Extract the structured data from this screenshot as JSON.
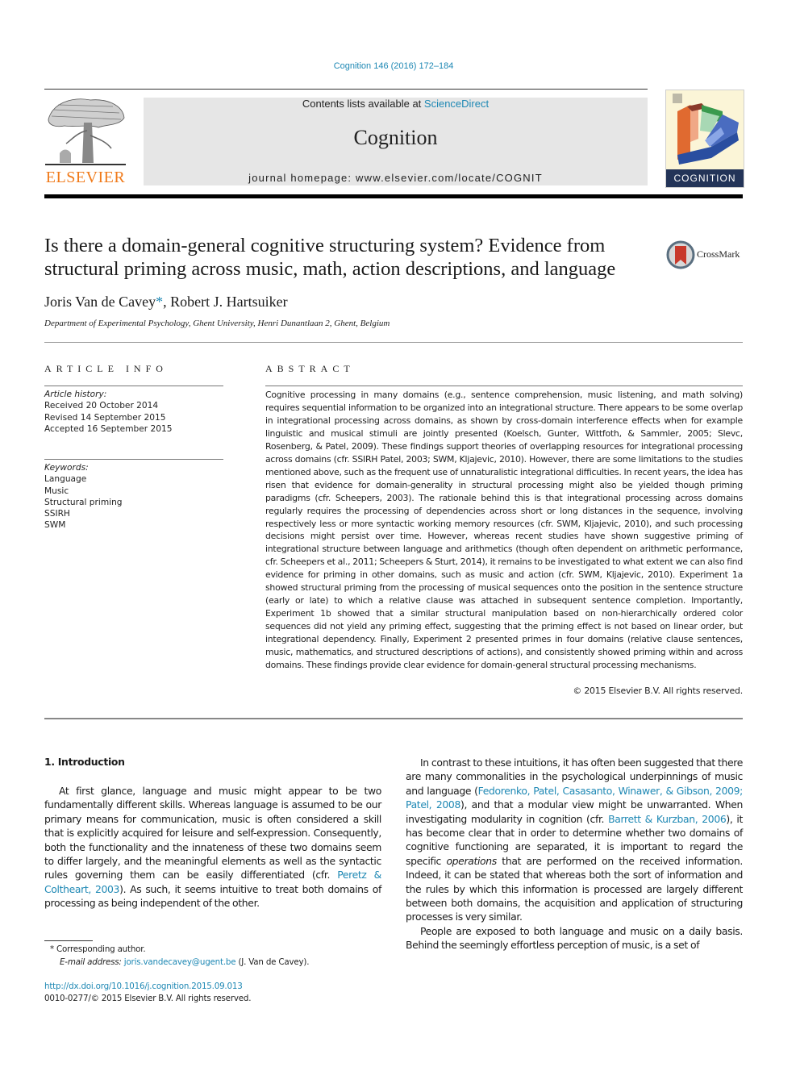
{
  "header": {
    "citation": "Cognition 146 (2016) 172–184",
    "contents_prefix": "Contents lists available at ",
    "contents_link": "ScienceDirect",
    "journal_title": "Cognition",
    "homepage": "journal homepage: www.elsevier.com/locate/COGNIT",
    "publisher_logo_text": "ELSEVIER",
    "cover_label": "COGNITION",
    "colors": {
      "link": "#1e88b4",
      "elsevier_orange": "#f07a1a",
      "cover_band": "#233458"
    }
  },
  "article": {
    "title": "Is there a domain-general cognitive structuring system? Evidence from structural priming across music, math, action descriptions, and language",
    "crossmark_label": "CrossMark",
    "authors": [
      {
        "name": "Joris Van de Cavey",
        "mark": "*"
      },
      {
        "name": "Robert J. Hartsuiker",
        "mark": ""
      }
    ],
    "author_separator": ", ",
    "affiliation": "Department of Experimental Psychology, Ghent University, Henri Dunantlaan 2, Ghent, Belgium"
  },
  "article_info": {
    "heading": "ARTICLE INFO",
    "history_label": "Article history:",
    "history": [
      "Received 20 October 2014",
      "Revised 14 September 2015",
      "Accepted 16 September 2015"
    ],
    "keywords_label": "Keywords:",
    "keywords": [
      "Language",
      "Music",
      "Structural priming",
      "SSIRH",
      "SWM"
    ]
  },
  "abstract": {
    "heading": "ABSTRACT",
    "text": "Cognitive processing in many domains (e.g., sentence comprehension, music listening, and math solving) requires sequential information to be organized into an integrational structure. There appears to be some overlap in integrational processing across domains, as shown by cross-domain interference effects when for example linguistic and musical stimuli are jointly presented (Koelsch, Gunter, Wittfoth, & Sammler, 2005; Slevc, Rosenberg, & Patel, 2009). These findings support theories of overlapping resources for integrational processing across domains (cfr. SSIRH Patel, 2003; SWM, Kljajevic, 2010). However, there are some limitations to the studies mentioned above, such as the frequent use of unnaturalistic integrational difficulties. In recent years, the idea has risen that evidence for domain-generality in structural processing might also be yielded though priming paradigms (cfr. Scheepers, 2003). The rationale behind this is that integrational processing across domains regularly requires the processing of dependencies across short or long distances in the sequence, involving respectively less or more syntactic working memory resources (cfr. SWM, Kljajevic, 2010), and such processing decisions might persist over time. However, whereas recent studies have shown suggestive priming of integrational structure between language and arithmetics (though often dependent on arithmetic performance, cfr. Scheepers et al., 2011; Scheepers & Sturt, 2014), it remains to be investigated to what extent we can also find evidence for priming in other domains, such as music and action (cfr. SWM, Kljajevic, 2010). Experiment 1a showed structural priming from the processing of musical sequences onto the position in the sentence structure (early or late) to which a relative clause was attached in subsequent sentence completion. Importantly, Experiment 1b showed that a similar structural manipulation based on non-hierarchically ordered color sequences did not yield any priming effect, suggesting that the priming effect is not based on linear order, but integrational dependency. Finally, Experiment 2 presented primes in four domains (relative clause sentences, music, mathematics, and structured descriptions of actions), and consistently showed priming within and across domains. These findings provide clear evidence for domain-general structural processing mechanisms.",
    "copyright": "© 2015 Elsevier B.V. All rights reserved."
  },
  "body": {
    "section_heading": "1. Introduction",
    "col1_p1": {
      "before": "At first glance, language and music might appear to be two fundamentally different skills. Whereas language is assumed to be our primary means for communication, music is often considered a skill that is explicitly acquired for leisure and self-expression. Consequently, both the functionality and the innateness of these two domains seem to differ largely, and the meaningful elements as well as the syntactic rules governing them can be easily differentiated (cfr. ",
      "link": "Peretz & Coltheart, 2003",
      "after": "). As such, it seems intuitive to treat both domains of processing as being independent of the other."
    },
    "col2_p1": {
      "t1": "In contrast to these intuitions, it has often been suggested that there are many commonalities in the psychological underpinnings of music and language (",
      "link1": "Fedorenko, Patel, Casasanto, Winawer, & Gibson, 2009; Patel, 2008",
      "t2": "), and that a modular view might be unwarranted. When investigating modularity in cognition (cfr. ",
      "link2": "Barrett & Kurzban, 2006",
      "t3": "), it has become clear that in order to determine whether two domains of cognitive functioning are separated, it is important to regard the specific ",
      "em": "operations",
      "t4": " that are performed on the received information. Indeed, it can be stated that whereas both the sort of information and the rules by which this information is processed are largely different between both domains, the acquisition and application of structuring processes is very similar."
    },
    "col2_p2": "People are exposed to both language and music on a daily basis. Behind the seemingly effortless perception of music, is a set of"
  },
  "footnotes": {
    "corresponding": "* Corresponding author.",
    "email_label": "E-mail address:",
    "email": "joris.vandecavey@ugent.be",
    "email_suffix": " (J. Van de Cavey).",
    "doi": "http://dx.doi.org/10.1016/j.cognition.2015.09.013",
    "issn_line": "0010-0277/© 2015 Elsevier B.V. All rights reserved."
  }
}
